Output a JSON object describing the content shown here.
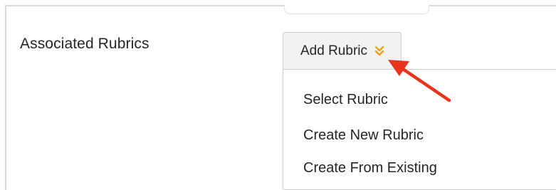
{
  "form": {
    "row_label": "Associated Rubrics"
  },
  "add_rubric": {
    "label": "Add Rubric",
    "icon": "double-chevron-down-icon",
    "icon_color": "#e8a317"
  },
  "dropdown": {
    "items": [
      {
        "label": "Select Rubric"
      },
      {
        "label": "Create New Rubric"
      },
      {
        "label": "Create From Existing"
      }
    ]
  },
  "annotation": {
    "arrow_color": "#e8341c"
  }
}
